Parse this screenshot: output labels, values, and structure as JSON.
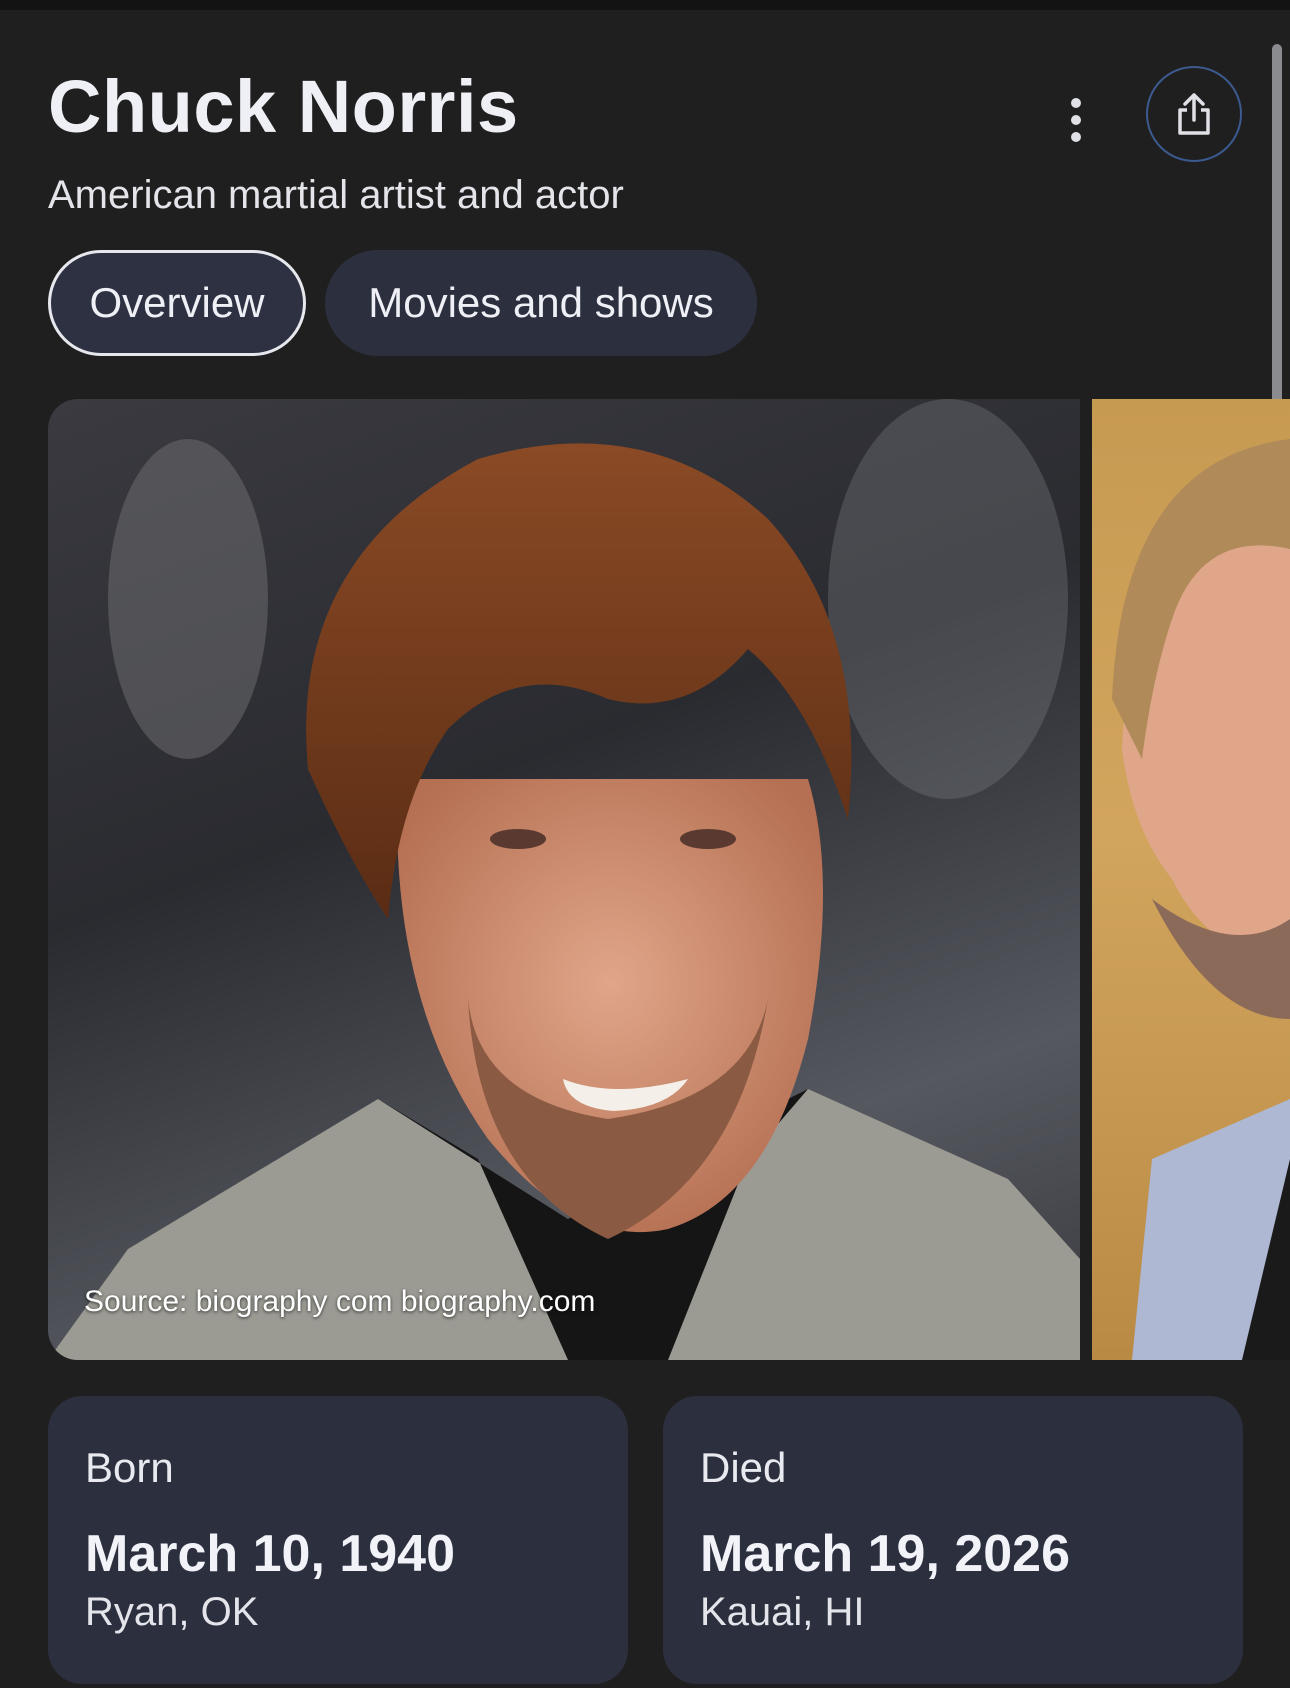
{
  "knowledge_panel": {
    "title": "Chuck Norris",
    "subtitle": "American martial artist and actor",
    "more_icon": "more-vert-icon",
    "share_icon": "share-icon"
  },
  "tabs": [
    {
      "label": "Overview",
      "selected": true
    },
    {
      "label": "Movies and shows",
      "selected": false
    }
  ],
  "images": {
    "main_source": "Source: biography com biography.com"
  },
  "facts": {
    "born": {
      "label": "Born",
      "date": "March 10, 1940",
      "place": "Ryan, OK"
    },
    "died": {
      "label": "Died",
      "date": "March 19, 2026",
      "place": "Kauai, HI"
    }
  },
  "colors": {
    "background": "#1f1f1f",
    "chip_background": "#2c2f3e",
    "share_ring": "#3c5a8f"
  }
}
